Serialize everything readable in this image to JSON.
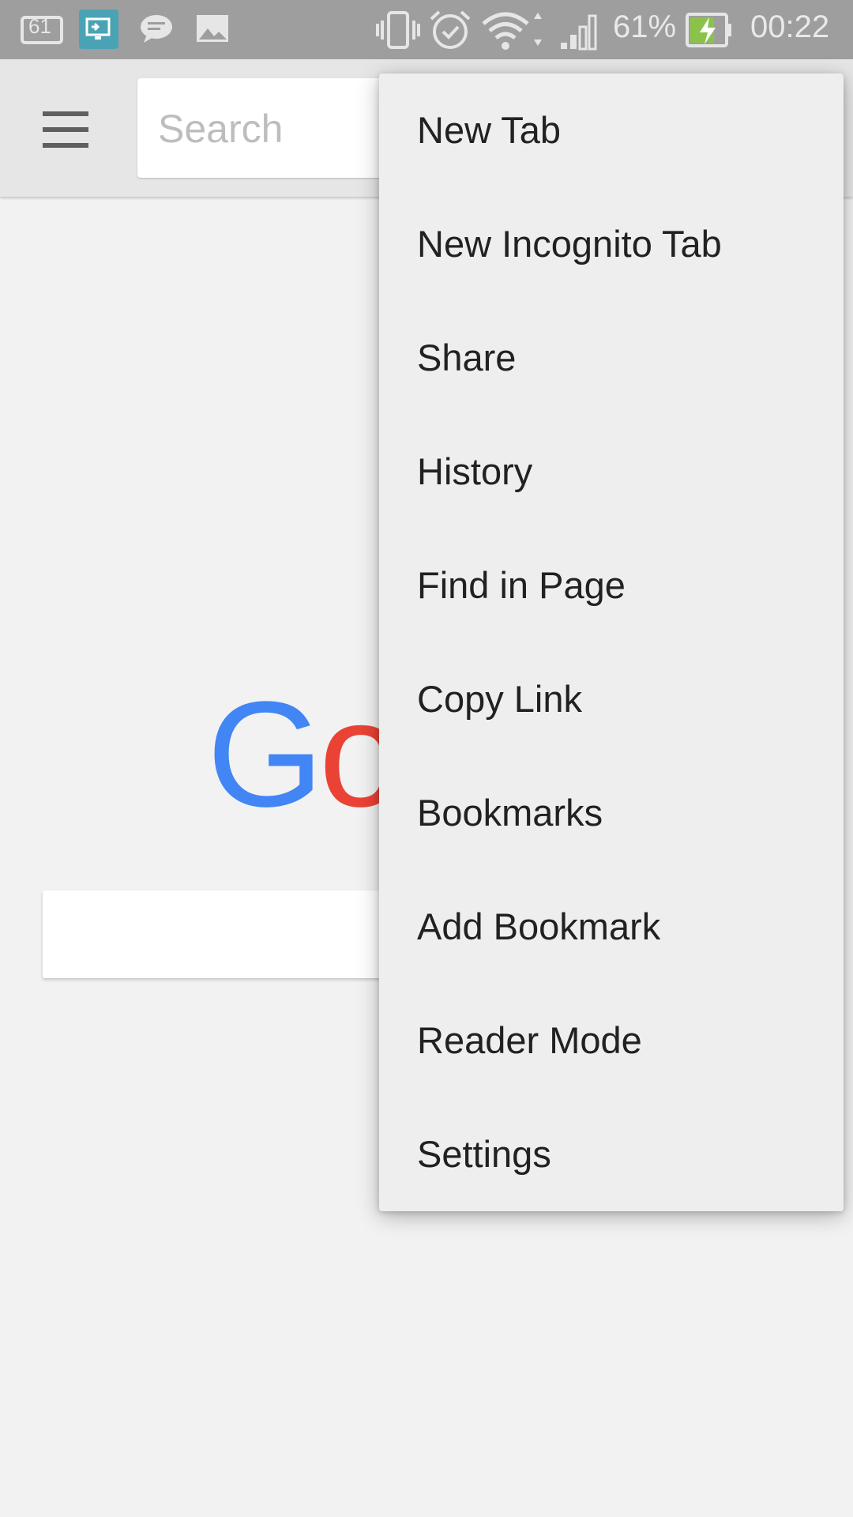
{
  "status_bar": {
    "notif_badge": "61",
    "battery_percent": "61%",
    "time": "00:22",
    "colors": {
      "bar": "#9e9e9e",
      "cast_icon_bg": "#4aa3b5",
      "battery_fill": "#8bc34a"
    },
    "icons": [
      "notification-61-icon",
      "screen-cast-icon",
      "chat-icon",
      "gallery-icon",
      "vibrate-icon",
      "alarm-icon",
      "wifi-icon",
      "signal-icon",
      "battery-charging-icon"
    ]
  },
  "toolbar": {
    "menu_icon": "hamburger-icon",
    "search_placeholder": "Search"
  },
  "logo": {
    "text_visible": "Go",
    "colors": [
      "#4285f4",
      "#ea4335"
    ]
  },
  "menu": {
    "items": [
      {
        "label": "New Tab"
      },
      {
        "label": "New Incognito Tab"
      },
      {
        "label": "Share"
      },
      {
        "label": "History"
      },
      {
        "label": "Find in Page"
      },
      {
        "label": "Copy Link"
      },
      {
        "label": "Bookmarks"
      },
      {
        "label": "Add Bookmark"
      },
      {
        "label": "Reader Mode"
      },
      {
        "label": "Settings"
      }
    ]
  }
}
